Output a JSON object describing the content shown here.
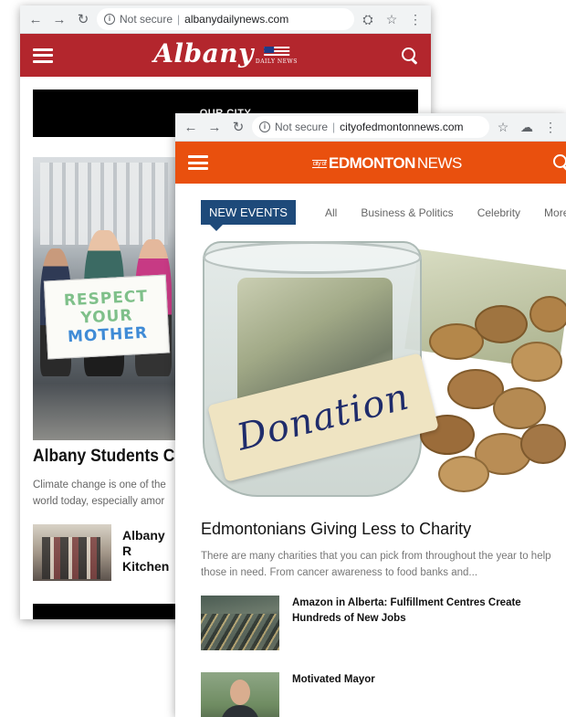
{
  "albany": {
    "browser": {
      "security_label": "Not secure",
      "separator": "|",
      "url": "albanydailynews.com"
    },
    "header": {
      "logo_word": "Albany",
      "logo_sub": "DAILY NEWS",
      "brand_color": "#b3262d"
    },
    "banner_text": "OUR CITY",
    "photo_sign": [
      "RESPECT",
      "YOUR",
      "MOTHER"
    ],
    "article": {
      "title": "Albany Students C",
      "summary": "Climate change is one of the world today, especially amor"
    },
    "related": {
      "title": "Albany R Kitchen"
    }
  },
  "edmonton": {
    "browser": {
      "security_label": "Not secure",
      "separator": "|",
      "url": "cityofedmontonnews.com"
    },
    "header": {
      "logo_prefix": "city of",
      "logo_bold": "EDMONTON",
      "logo_light": "NEWS",
      "brand_color": "#e9500e"
    },
    "tabs": {
      "badge": "NEW EVENTS",
      "items": [
        "All",
        "Business & Politics",
        "Celebrity"
      ],
      "more": "More"
    },
    "hero_label": "Donation",
    "article": {
      "title": "Edmontonians Giving Less to Charity",
      "summary": "There are many charities that you can pick from throughout the year to help those in need. From cancer awareness to food banks and..."
    },
    "related": [
      {
        "title": "Amazon in Alberta: Fulfillment Centres Create Hundreds of New Jobs"
      },
      {
        "title": "Motivated Mayor"
      }
    ],
    "accent_color": "#1e4a7a"
  },
  "icons": [
    "back-arrow-icon",
    "forward-arrow-icon",
    "reload-icon",
    "info-icon",
    "translate-icon",
    "star-icon",
    "menu-dots-icon",
    "extension-icon",
    "hamburger-icon",
    "search-icon"
  ]
}
